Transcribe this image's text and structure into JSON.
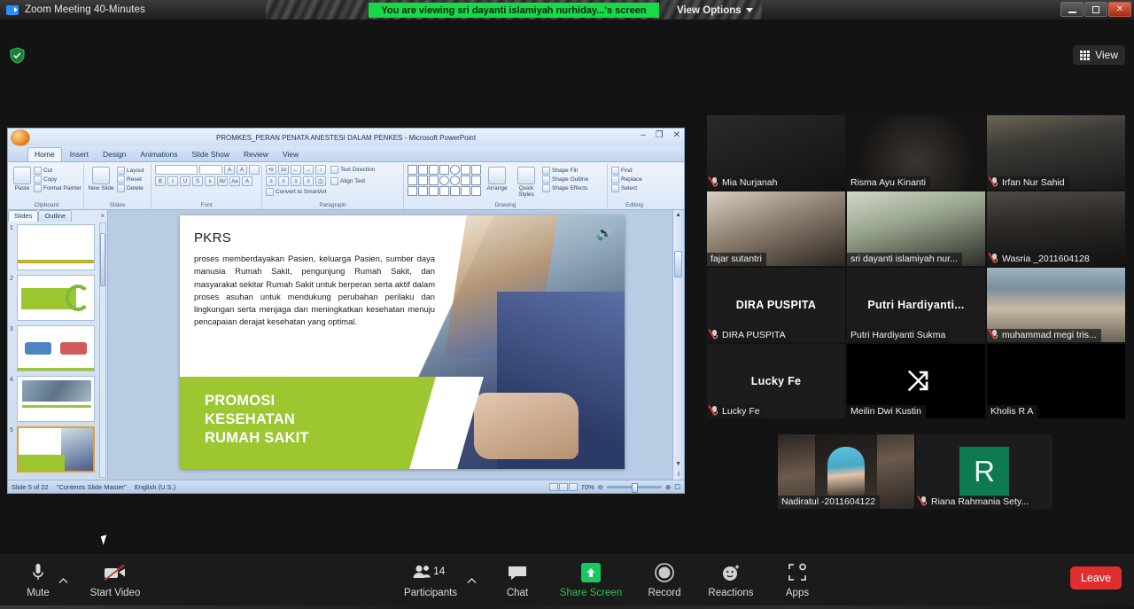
{
  "window": {
    "title": "Zoom Meeting 40-Minutes",
    "logo_icon": "zoom-camera-icon",
    "share_banner": "You are viewing sri dayanti islamiyah nurhiday...'s screen",
    "view_options": "View Options",
    "minimize": "minimize-icon",
    "restore": "restore-icon",
    "close": "✕"
  },
  "topbar": {
    "shield_icon": "encryption-shield-icon",
    "view_button": "View",
    "view_icon": "grid-view-icon"
  },
  "powerpoint": {
    "title": "PROMKES_PERAN PENATA ANESTESI DALAM PENKES - Microsoft PowerPoint",
    "office_button": "office-orb-icon",
    "win_minimize": "–",
    "win_restore": "❐",
    "win_close": "✕",
    "tabs": [
      "Home",
      "Insert",
      "Design",
      "Animations",
      "Slide Show",
      "Review",
      "View"
    ],
    "active_tab": "Home",
    "ribbon": {
      "clipboard": {
        "label": "Clipboard",
        "paste": "Paste",
        "items": [
          "Cut",
          "Copy",
          "Format Painter"
        ]
      },
      "slides": {
        "label": "Slides",
        "new_slide": "New Slide",
        "items": [
          "Layout",
          "Reset",
          "Delete"
        ]
      },
      "font": {
        "label": "Font",
        "grow": "A",
        "shrink": "A",
        "clear": "✘"
      },
      "paragraph": {
        "label": "Paragraph",
        "items": [
          "Text Direction",
          "Align Text",
          "Convert to SmartArt"
        ]
      },
      "drawing": {
        "label": "Drawing",
        "arrange": "Arrange",
        "quick_styles": "Quick Styles",
        "items": [
          "Shape Fill",
          "Shape Outline",
          "Shape Effects"
        ]
      },
      "editing": {
        "label": "Editing",
        "items": [
          "Find",
          "Replace",
          "Select"
        ]
      }
    },
    "panes": {
      "slides_tab": "Slides",
      "outline_tab": "Outline",
      "close_icon": "close-pane-icon",
      "thumbnails": [
        "1",
        "2",
        "3",
        "4",
        "5"
      ],
      "selected_thumbnail": "5"
    },
    "slide": {
      "heading": "PKRS",
      "body": "proses memberdayakan Pasien, keluarga Pasien, sumber daya manusia Rumah Sakit, pengunjung Rumah Sakit, dan masyarakat sekitar Rumah Sakit untuk berperan serta aktif dalam proses asuhan untuk mendukung perubahan perilaku dan lingkungan serta menjaga dan meningkatkan kesehatan menuju pencapaian derajat kesehatan yang optimal.",
      "banner_line1": "PROMOSI",
      "banner_line2": "KESEHATAN",
      "banner_line3": "RUMAH SAKIT",
      "banner_color": "#9cc731",
      "sound_icon": "speaker-icon"
    },
    "status": {
      "slide_counter": "Slide 5 of 22",
      "master": "\"Contents Slide Master\"",
      "language": "English (U.S.)",
      "zoom_level": "70%",
      "zoom_out": "⊖",
      "zoom_in": "⊕",
      "fit_icon": "fit-slide-icon"
    }
  },
  "participants": {
    "rows": [
      [
        {
          "name": "Mia Nurjanah",
          "muted": true,
          "kind": "video",
          "style": "p-dark"
        },
        {
          "name": "Risma Ayu Kinanti",
          "muted": false,
          "kind": "video",
          "style": "p-risma"
        },
        {
          "name": "Irfan Nur Sahid",
          "muted": true,
          "kind": "video",
          "style": "p-irfan"
        }
      ],
      [
        {
          "name": "fajar sutantri",
          "muted": false,
          "kind": "video",
          "style": "p-fajar"
        },
        {
          "name": "sri dayanti islamiyah nur...",
          "muted": false,
          "kind": "video",
          "style": "p-sri",
          "active_speaker": true
        },
        {
          "name": "Wasria _2011604128",
          "muted": true,
          "kind": "video",
          "style": "p-wasria"
        }
      ],
      [
        {
          "name": "DIRA PUSPITA",
          "muted": true,
          "kind": "name",
          "display_name": "DIRA PUSPITA"
        },
        {
          "name": "Putri Hardiyanti Sukma",
          "muted": false,
          "kind": "name",
          "display_name": "Putri  Hardiyanti..."
        },
        {
          "name": "muhammad megi tris...",
          "muted": true,
          "kind": "video",
          "style": "p-megi"
        }
      ],
      [
        {
          "name": "Lucky Fe",
          "muted": true,
          "kind": "name",
          "display_name": "Lucky Fe"
        },
        {
          "name": "Meilin Dwi Kustin",
          "muted": false,
          "kind": "logo",
          "logo": "⤨"
        },
        {
          "name": "Kholis R A",
          "muted": false,
          "kind": "video",
          "style": "p-black"
        }
      ]
    ],
    "bottom_row": [
      {
        "name": "Nadiratul -2011604122",
        "muted": false,
        "kind": "video",
        "style": "p-nadira"
      },
      {
        "name": "Riana Rahmania Sety...",
        "muted": true,
        "kind": "letter",
        "letter": "R",
        "avatar_color": "#0e7a52"
      }
    ]
  },
  "toolbar": {
    "mute": {
      "label": "Mute",
      "icon": "microphone-icon"
    },
    "start_video": {
      "label": "Start Video",
      "icon": "camera-off-icon"
    },
    "participants": {
      "label": "Participants",
      "count": "14",
      "icon": "people-icon"
    },
    "chat": {
      "label": "Chat",
      "icon": "chat-bubble-icon"
    },
    "share_screen": {
      "label": "Share Screen",
      "icon": "share-arrow-icon",
      "color": "#2fbf5a"
    },
    "record": {
      "label": "Record",
      "icon": "record-circle-icon"
    },
    "reactions": {
      "label": "Reactions",
      "icon": "smiley-icon"
    },
    "apps": {
      "label": "Apps",
      "icon": "apps-icon"
    },
    "leave": {
      "label": "Leave",
      "color": "#e02d2d"
    }
  }
}
